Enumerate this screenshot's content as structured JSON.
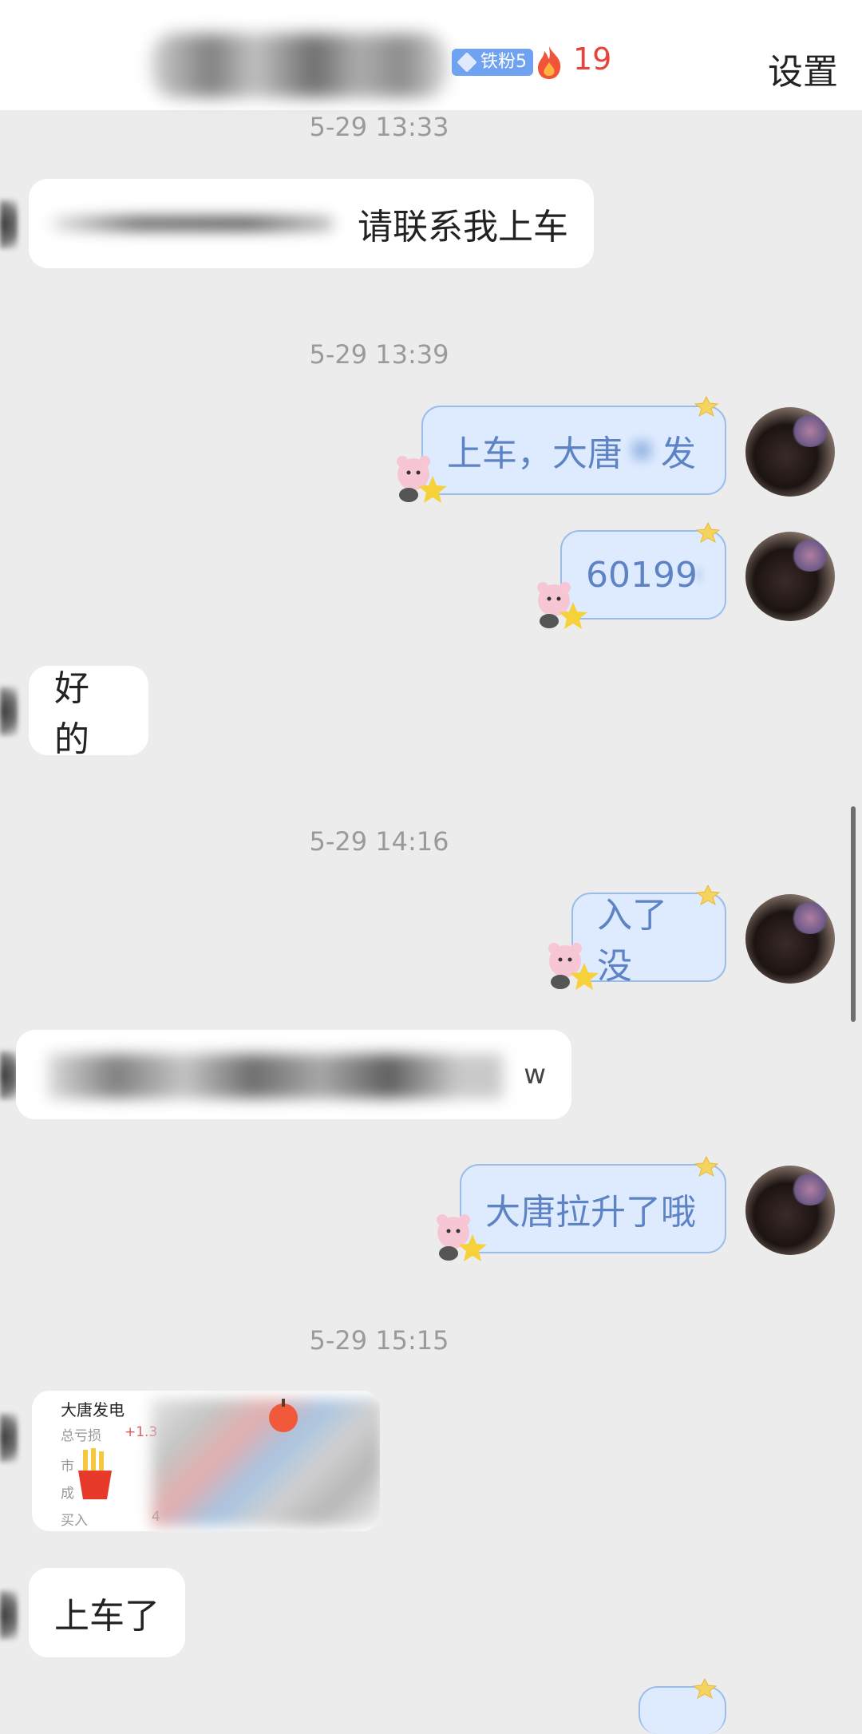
{
  "header": {
    "fan_badge": "铁粉5",
    "streak": "19",
    "settings": "设置"
  },
  "messages": {
    "t1": "5-29 13:33",
    "m1": "请联系我上车",
    "t2": "5-29 13:39",
    "m2": "上车，大唐",
    "m2b": "发",
    "m3": "60199",
    "m4": "好的",
    "t3": "5-29 14:16",
    "m5": "入了没",
    "m6": "w",
    "m7": "大唐拉升了哦",
    "t4": "5-29 15:15",
    "m8": "上车了"
  },
  "card": {
    "title": "大唐发电",
    "row1": "总亏损",
    "row2": "市",
    "row3": "成",
    "row4": "买入",
    "row1_val": "+1.3",
    "row4_val": "4"
  },
  "colors": {
    "outgoing_bubble": "#deebff",
    "outgoing_text": "#5d83c4",
    "streak": "#e8433a",
    "badge": "#6fa2f0"
  },
  "icons": [
    "diamond-icon",
    "fire-icon",
    "bear-sticker-icon",
    "star-icon"
  ]
}
